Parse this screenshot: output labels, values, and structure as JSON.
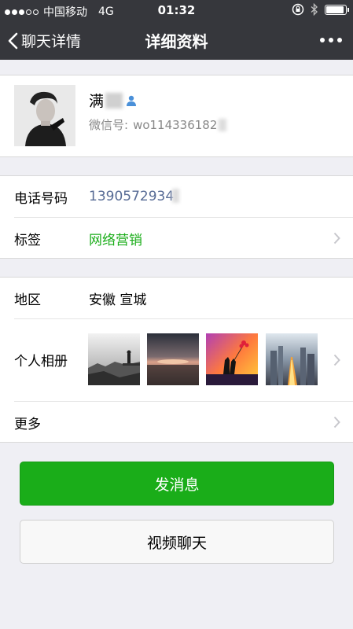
{
  "status_bar": {
    "carrier": "中国移动",
    "network": "4G",
    "time": "01:32"
  },
  "nav": {
    "back_label": "聊天详情",
    "title": "详细资料"
  },
  "profile": {
    "name": "满",
    "wechat_id_label": "微信号:",
    "wechat_id": "wo114336182"
  },
  "info": {
    "phone_label": "电话号码",
    "phone_value": "1390572934",
    "tags_label": "标签",
    "tags_value": "网络营销",
    "region_label": "地区",
    "region_value": "安徽  宣城",
    "album_label": "个人相册",
    "more_label": "更多"
  },
  "buttons": {
    "send_message": "发消息",
    "video_chat": "视频聊天"
  },
  "colors": {
    "nav_bg": "#36373c",
    "accent_green": "#1aad19",
    "link_blue": "#576b95"
  }
}
